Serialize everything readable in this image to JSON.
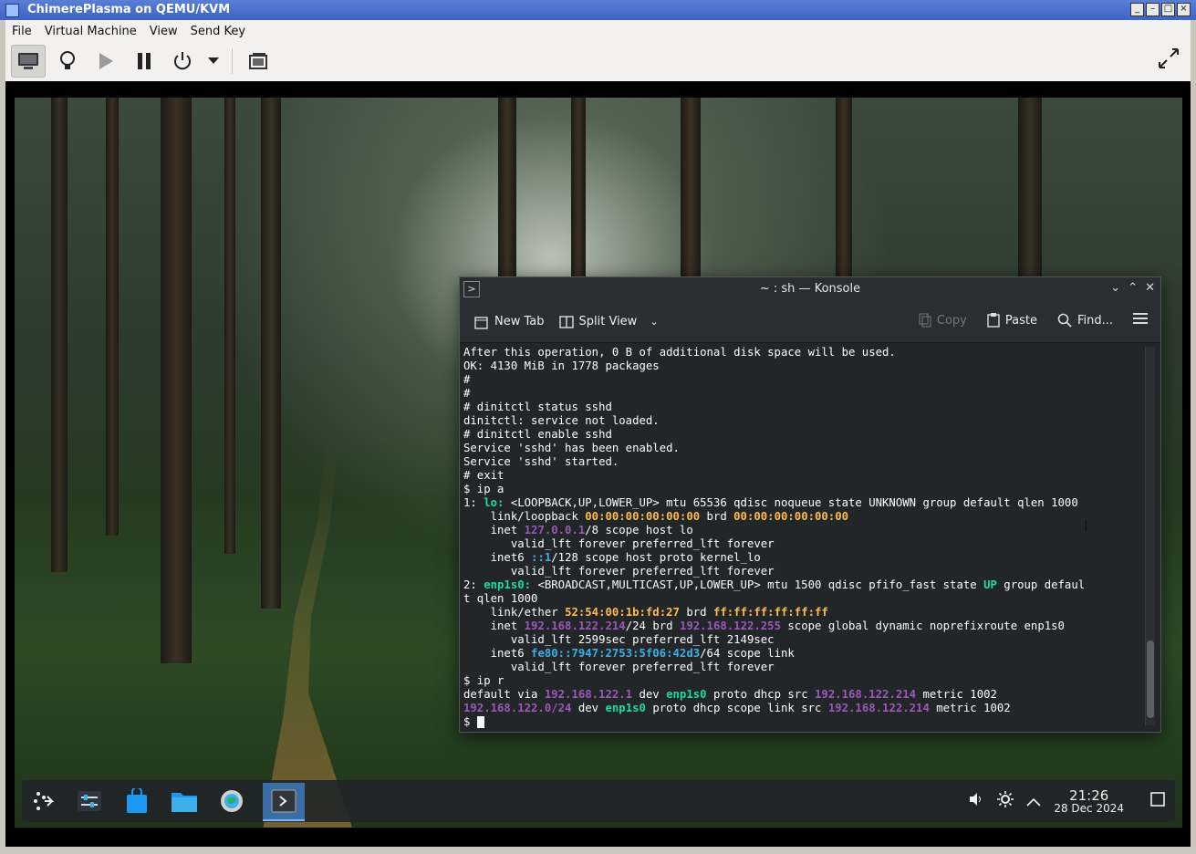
{
  "vm_window": {
    "title": "ChimerePlasma on QEMU/KVM",
    "menu": [
      "File",
      "Virtual Machine",
      "View",
      "Send Key"
    ]
  },
  "konsole": {
    "title": "~ : sh — Konsole",
    "toolbar": {
      "new_tab": "New Tab",
      "split_view": "Split View",
      "copy": "Copy",
      "paste": "Paste",
      "find": "Find..."
    }
  },
  "terminal_lines": [
    [
      {
        "t": "After this operation, 0 B of additional disk space will be used."
      }
    ],
    [
      {
        "t": "OK: 4130 MiB in 1778 packages"
      }
    ],
    [
      {
        "t": "#"
      }
    ],
    [
      {
        "t": "#"
      }
    ],
    [
      {
        "t": "# dinitctl status sshd"
      }
    ],
    [
      {
        "t": "dinitctl: service not loaded."
      }
    ],
    [
      {
        "t": "# dinitctl enable sshd"
      }
    ],
    [
      {
        "t": "Service 'sshd' has been enabled."
      }
    ],
    [
      {
        "t": "Service 'sshd' started."
      }
    ],
    [
      {
        "t": "# exit"
      }
    ],
    [
      {
        "t": "$ ip a"
      }
    ],
    [
      {
        "t": "1: "
      },
      {
        "t": "lo:",
        "c": "c-g"
      },
      {
        "t": " <LOOPBACK,UP,LOWER_UP> mtu 65536 qdisc noqueue state UNKNOWN group default qlen 1000"
      }
    ],
    [
      {
        "t": "    link/loopback "
      },
      {
        "t": "00:00:00:00:00:00",
        "c": "c-y"
      },
      {
        "t": " brd "
      },
      {
        "t": "00:00:00:00:00:00",
        "c": "c-y"
      }
    ],
    [
      {
        "t": "    inet "
      },
      {
        "t": "127.0.0.1",
        "c": "c-p"
      },
      {
        "t": "/8 scope host lo"
      }
    ],
    [
      {
        "t": "       valid_lft forever preferred_lft forever"
      }
    ],
    [
      {
        "t": "    inet6 "
      },
      {
        "t": "::1",
        "c": "c-b"
      },
      {
        "t": "/128 scope host proto kernel_lo"
      }
    ],
    [
      {
        "t": "       valid_lft forever preferred_lft forever"
      }
    ],
    [
      {
        "t": "2: "
      },
      {
        "t": "enp1s0:",
        "c": "c-g"
      },
      {
        "t": " <BROADCAST,MULTICAST,UP,LOWER_UP> mtu 1500 qdisc pfifo_fast state "
      },
      {
        "t": "UP",
        "c": "c-gr"
      },
      {
        "t": " group defaul"
      }
    ],
    [
      {
        "t": "t qlen 1000"
      }
    ],
    [
      {
        "t": "    link/ether "
      },
      {
        "t": "52:54:00:1b:fd:27",
        "c": "c-y"
      },
      {
        "t": " brd "
      },
      {
        "t": "ff:ff:ff:ff:ff:ff",
        "c": "c-y"
      }
    ],
    [
      {
        "t": "    inet "
      },
      {
        "t": "192.168.122.214",
        "c": "c-p"
      },
      {
        "t": "/24 brd "
      },
      {
        "t": "192.168.122.255",
        "c": "c-p"
      },
      {
        "t": " scope global dynamic noprefixroute enp1s0"
      }
    ],
    [
      {
        "t": "       valid_lft 2599sec preferred_lft 2149sec"
      }
    ],
    [
      {
        "t": "    inet6 "
      },
      {
        "t": "fe80::7947:2753:5f06:42d3",
        "c": "c-b"
      },
      {
        "t": "/64 scope link"
      }
    ],
    [
      {
        "t": "       valid_lft forever preferred_lft forever"
      }
    ],
    [
      {
        "t": "$ ip r"
      }
    ],
    [
      {
        "t": "default via "
      },
      {
        "t": "192.168.122.1",
        "c": "c-p"
      },
      {
        "t": " dev "
      },
      {
        "t": "enp1s0",
        "c": "c-g"
      },
      {
        "t": " proto dhcp src "
      },
      {
        "t": "192.168.122.214",
        "c": "c-p"
      },
      {
        "t": " metric 1002"
      }
    ],
    [
      {
        "t": "192.168.122.0/24",
        "c": "c-p"
      },
      {
        "t": " dev "
      },
      {
        "t": "enp1s0",
        "c": "c-g"
      },
      {
        "t": " proto dhcp scope link src "
      },
      {
        "t": "192.168.122.214",
        "c": "c-p"
      },
      {
        "t": " metric 1002"
      }
    ],
    [
      {
        "t": "$ "
      }
    ]
  ],
  "taskbar": {
    "time": "21:26",
    "date": "28 Dec 2024"
  },
  "colors": {
    "accent": "#3daee9",
    "terminal_bg": "#232629"
  }
}
